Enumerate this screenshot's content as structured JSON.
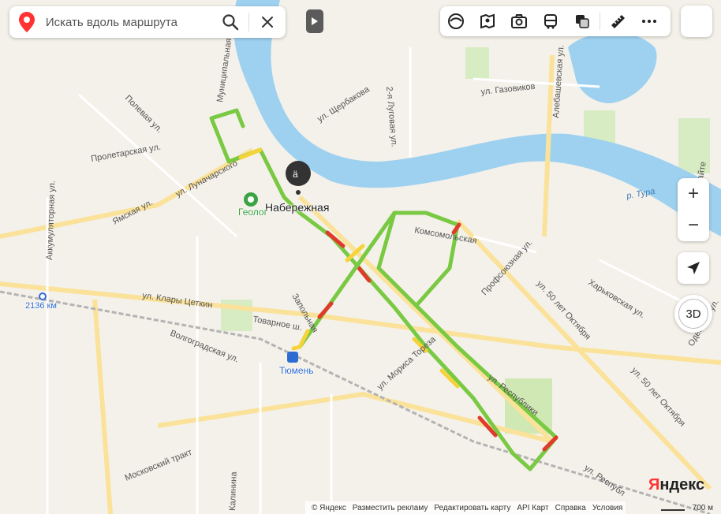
{
  "search": {
    "placeholder": "Искать вдоль маршрута"
  },
  "toolbar": {
    "icons": [
      "layers-icon",
      "panorama-icon",
      "photo-icon",
      "transport-icon",
      "route-icon",
      "ruler-icon",
      "more-icon"
    ]
  },
  "map": {
    "streets": {
      "munitsipalnaya": "Муниципальная ул.",
      "polevaya": "Полевая ул.",
      "proletarskaya": "Пролетарская ул.",
      "lunacharskogo": "ул. Луначарского",
      "yamskaya": "Ямская ул.",
      "akkumulyatornaya": "Аккумуляторная ул.",
      "klary_tsetkin": "ул. Клары Цеткин",
      "tovarnoe": "Товарное ш.",
      "volgogradskaya": "Волгоградская ул.",
      "moskovsky": "Московский тракт",
      "kalinina": "Калинина",
      "zapolnaya": "Запольная",
      "shcherbakova": "ул. Щербакова",
      "lugovaya": "2-я Луговая ул.",
      "gazovikov": "ул. Газовиков",
      "alebashevskaya": "Алебашевская ул.",
      "komsomolskaya": "Комсомольская",
      "profsoyuznaya": "Профсоюзная ул.",
      "let_oktyabrya_1": "ул. 50 лет Октября",
      "let_oktyabrya_2": "ул. 50 лет Октября",
      "kharkovskaya": "Харьковская ул.",
      "mory_ereza": "ул. Мориса Тореза",
      "respubliki": "ул. Республики",
      "respubliki_2": "ул. Республ",
      "odesskaya": "Одесская ул.",
      "melnikaite": "ул. Мельникайте",
      "tura": "р. Тура"
    },
    "pois": {
      "naberezhnaya": "Набережная",
      "geolog": "Геолог",
      "tyumen": "Тюмень",
      "station": "2136 км"
    },
    "colors": {
      "water": "#9ed1f0",
      "green_route": "#7ac943",
      "yellow_route": "#f5d33a",
      "red_route": "#e03a2b"
    }
  },
  "controls": {
    "zoom_in": "+",
    "zoom_out": "−",
    "three_d": "3D"
  },
  "branding": {
    "logo_y": "Я",
    "logo_rest": "ндекс"
  },
  "footer": {
    "copyright": "© Яндекс",
    "links": [
      "Разместить рекламу",
      "Редактировать карту",
      "API Карт",
      "Справка",
      "Условия"
    ]
  },
  "scale": {
    "label": "700 м"
  }
}
